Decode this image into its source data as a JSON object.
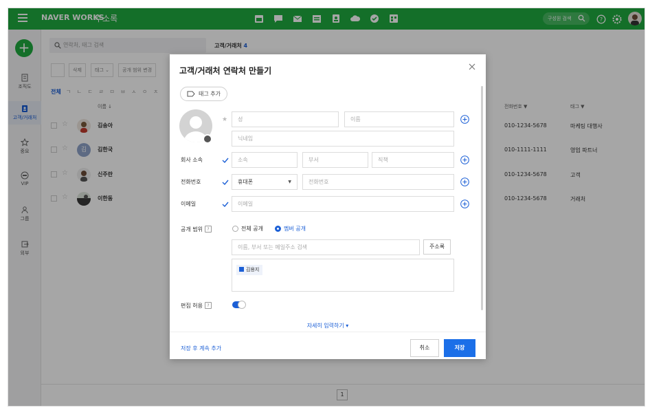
{
  "topbar": {
    "brand": "NAVER WORKS",
    "app_name": "주소록",
    "colleague_search": "구성원 검색"
  },
  "sidebar": {
    "items": [
      {
        "label": "조직도"
      },
      {
        "label": "고객/거래처"
      },
      {
        "label": "중요"
      },
      {
        "label": "VIP"
      },
      {
        "label": "그룹"
      },
      {
        "label": "외부"
      }
    ]
  },
  "main": {
    "search_placeholder": "연락처, 태그 검색",
    "list_title": "고객/거래처",
    "list_count": "4",
    "toolbar": {
      "delete": "삭제",
      "tag": "태그 ⌄",
      "scope": "공개 범위 변경"
    },
    "index": {
      "all": "전체",
      "letters": "ㄱ ㄴ ㄷ ㄹ ㅁ ㅂ ㅅ ㅇ ㅈ"
    },
    "columns": {
      "name": "이름 ↓",
      "phone": "전화번호 ▼",
      "tag": "태그 ▼"
    },
    "contacts": [
      {
        "name": "김송아",
        "phone": "010-1234-5678",
        "tag": "마케팅 대행사"
      },
      {
        "name": "김한국",
        "phone": "010-1111-1111",
        "tag": "영업 파트너",
        "initial": "김"
      },
      {
        "name": "신주란",
        "phone": "010-1234-5678",
        "tag": "고객"
      },
      {
        "name": "이한동",
        "phone": "010-1234-5678",
        "tag": "거래처"
      }
    ],
    "page": "1"
  },
  "modal": {
    "title": "고객/거래처 연락처 만들기",
    "tag_add": "태그 추가",
    "fields": {
      "last_name": "성",
      "first_name": "이름",
      "nickname": "닉네임",
      "company_label": "회사 소속",
      "company": "소속",
      "department": "부서",
      "position": "직책",
      "phone_label": "전화번호",
      "phone_type": "휴대폰",
      "phone": "전화번호",
      "email_label": "이메일",
      "email": "이메일"
    },
    "scope": {
      "label": "공개 범위",
      "option_all": "전체 공개",
      "option_member": "멤버 공개",
      "member_search_placeholder": "이름, 부서 또는 메일주소 검색",
      "addressbook_button": "주소록",
      "member_chip": "김용지"
    },
    "edit_allow_label": "편집 허용",
    "edit_allowed": true,
    "more_link": "자세히 입력하기 ▾",
    "save_continue": "저장 후 계속 추가",
    "cancel": "취소",
    "save": "저장"
  },
  "colors": {
    "brand_green": "#1fab3f",
    "accent_blue": "#1b5fd6",
    "primary_button": "#1b6fe8"
  }
}
